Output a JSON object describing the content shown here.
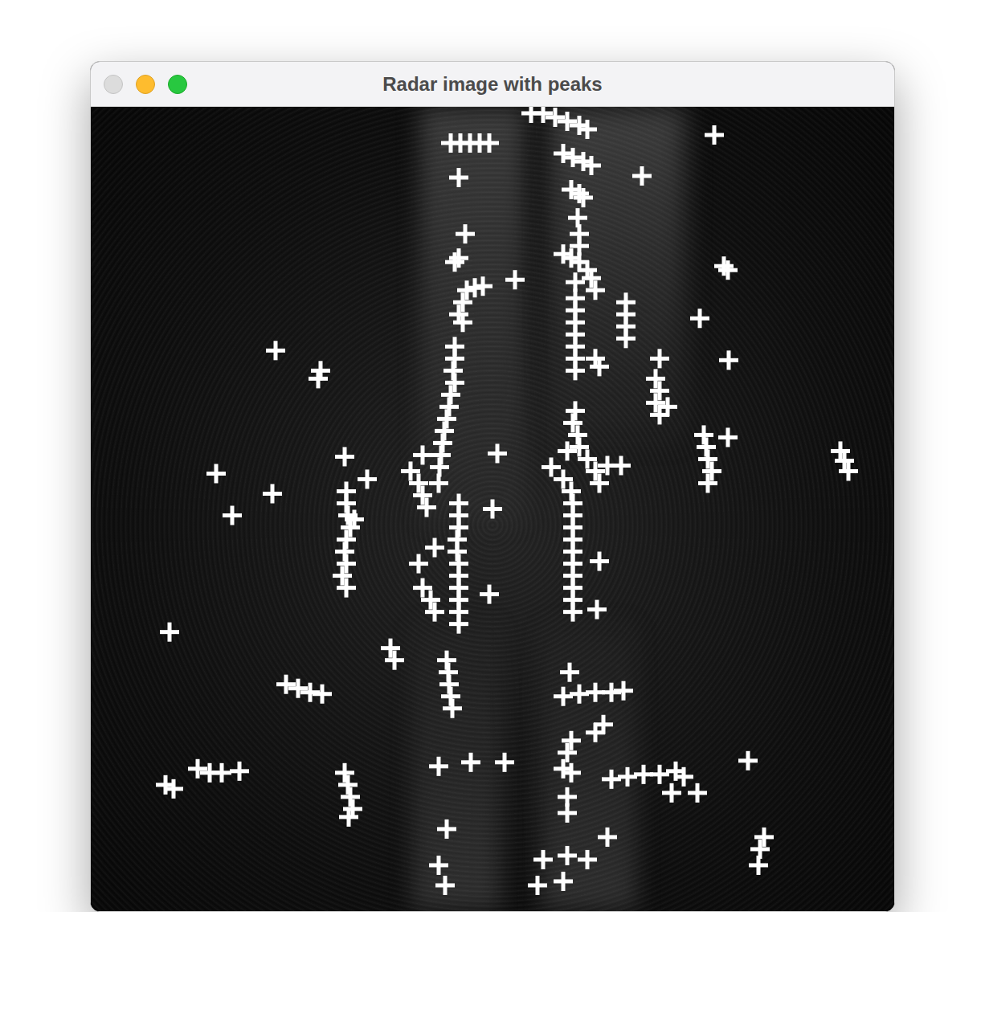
{
  "window": {
    "title": "Radar image with peaks",
    "controls": [
      {
        "name": "close",
        "disabled": true
      },
      {
        "name": "minimize",
        "disabled": false
      },
      {
        "name": "zoom",
        "disabled": false
      }
    ]
  },
  "radar_image": {
    "peaks": {
      "points": [
        [
          548,
          8
        ],
        [
          563,
          8
        ],
        [
          578,
          13
        ],
        [
          593,
          18
        ],
        [
          608,
          23
        ],
        [
          618,
          28
        ],
        [
          776,
          35
        ],
        [
          448,
          45
        ],
        [
          460,
          45
        ],
        [
          472,
          45
        ],
        [
          484,
          45
        ],
        [
          496,
          45
        ],
        [
          588,
          58
        ],
        [
          600,
          63
        ],
        [
          613,
          68
        ],
        [
          623,
          73
        ],
        [
          458,
          88
        ],
        [
          686,
          86
        ],
        [
          598,
          103
        ],
        [
          608,
          108
        ],
        [
          613,
          113
        ],
        [
          606,
          138
        ],
        [
          608,
          158
        ],
        [
          608,
          173
        ],
        [
          466,
          158
        ],
        [
          458,
          188
        ],
        [
          453,
          193
        ],
        [
          588,
          183
        ],
        [
          598,
          188
        ],
        [
          608,
          193
        ],
        [
          618,
          203
        ],
        [
          623,
          213
        ],
        [
          628,
          228
        ],
        [
          528,
          215
        ],
        [
          468,
          228
        ],
        [
          478,
          225
        ],
        [
          488,
          223
        ],
        [
          463,
          243
        ],
        [
          458,
          258
        ],
        [
          463,
          268
        ],
        [
          788,
          198
        ],
        [
          793,
          203
        ],
        [
          603,
          218
        ],
        [
          603,
          238
        ],
        [
          603,
          253
        ],
        [
          603,
          268
        ],
        [
          603,
          283
        ],
        [
          603,
          298
        ],
        [
          603,
          313
        ],
        [
          603,
          328
        ],
        [
          666,
          243
        ],
        [
          666,
          258
        ],
        [
          666,
          273
        ],
        [
          666,
          288
        ],
        [
          758,
          263
        ],
        [
          453,
          298
        ],
        [
          453,
          313
        ],
        [
          451,
          328
        ],
        [
          453,
          343
        ],
        [
          448,
          358
        ],
        [
          446,
          373
        ],
        [
          443,
          388
        ],
        [
          440,
          403
        ],
        [
          438,
          418
        ],
        [
          436,
          433
        ],
        [
          434,
          448
        ],
        [
          433,
          468
        ],
        [
          628,
          313
        ],
        [
          633,
          323
        ],
        [
          708,
          313
        ],
        [
          703,
          338
        ],
        [
          708,
          353
        ],
        [
          703,
          368
        ],
        [
          708,
          383
        ],
        [
          718,
          373
        ],
        [
          794,
          315
        ],
        [
          230,
          303
        ],
        [
          286,
          328
        ],
        [
          283,
          338
        ],
        [
          603,
          378
        ],
        [
          600,
          393
        ],
        [
          606,
          408
        ],
        [
          593,
          428
        ],
        [
          608,
          423
        ],
        [
          618,
          438
        ],
        [
          628,
          453
        ],
        [
          643,
          446
        ],
        [
          660,
          446
        ],
        [
          633,
          468
        ],
        [
          763,
          408
        ],
        [
          766,
          423
        ],
        [
          768,
          438
        ],
        [
          773,
          453
        ],
        [
          768,
          468
        ],
        [
          793,
          411
        ],
        [
          933,
          428
        ],
        [
          938,
          440
        ],
        [
          943,
          453
        ],
        [
          316,
          435
        ],
        [
          344,
          463
        ],
        [
          413,
          433
        ],
        [
          398,
          453
        ],
        [
          408,
          468
        ],
        [
          413,
          483
        ],
        [
          418,
          498
        ],
        [
          506,
          431
        ],
        [
          156,
          456
        ],
        [
          226,
          481
        ],
        [
          176,
          508
        ],
        [
          318,
          478
        ],
        [
          318,
          493
        ],
        [
          320,
          508
        ],
        [
          323,
          523
        ],
        [
          318,
          538
        ],
        [
          316,
          553
        ],
        [
          318,
          568
        ],
        [
          313,
          583
        ],
        [
          318,
          598
        ],
        [
          328,
          513
        ],
        [
          573,
          448
        ],
        [
          588,
          463
        ],
        [
          598,
          478
        ],
        [
          600,
          493
        ],
        [
          600,
          508
        ],
        [
          600,
          523
        ],
        [
          600,
          538
        ],
        [
          600,
          553
        ],
        [
          600,
          568
        ],
        [
          600,
          583
        ],
        [
          600,
          598
        ],
        [
          600,
          613
        ],
        [
          600,
          628
        ],
        [
          500,
          500
        ],
        [
          458,
          493
        ],
        [
          458,
          508
        ],
        [
          458,
          523
        ],
        [
          456,
          538
        ],
        [
          456,
          553
        ],
        [
          458,
          568
        ],
        [
          458,
          583
        ],
        [
          458,
          598
        ],
        [
          458,
          613
        ],
        [
          458,
          628
        ],
        [
          458,
          643
        ],
        [
          428,
          548
        ],
        [
          408,
          568
        ],
        [
          633,
          565
        ],
        [
          413,
          598
        ],
        [
          423,
          613
        ],
        [
          428,
          628
        ],
        [
          496,
          606
        ],
        [
          630,
          625
        ],
        [
          98,
          653
        ],
        [
          373,
          673
        ],
        [
          378,
          688
        ],
        [
          443,
          688
        ],
        [
          445,
          703
        ],
        [
          446,
          718
        ],
        [
          448,
          733
        ],
        [
          450,
          748
        ],
        [
          596,
          703
        ],
        [
          243,
          718
        ],
        [
          258,
          723
        ],
        [
          273,
          728
        ],
        [
          288,
          730
        ],
        [
          588,
          733
        ],
        [
          608,
          730
        ],
        [
          628,
          728
        ],
        [
          648,
          728
        ],
        [
          663,
          726
        ],
        [
          638,
          768
        ],
        [
          628,
          778
        ],
        [
          598,
          788
        ],
        [
          593,
          803
        ],
        [
          433,
          820
        ],
        [
          473,
          815
        ],
        [
          515,
          815
        ],
        [
          588,
          823
        ],
        [
          598,
          828
        ],
        [
          818,
          813
        ],
        [
          133,
          823
        ],
        [
          148,
          828
        ],
        [
          163,
          828
        ],
        [
          185,
          826
        ],
        [
          93,
          843
        ],
        [
          103,
          848
        ],
        [
          316,
          828
        ],
        [
          320,
          843
        ],
        [
          323,
          858
        ],
        [
          326,
          873
        ],
        [
          321,
          883
        ],
        [
          648,
          836
        ],
        [
          668,
          833
        ],
        [
          688,
          830
        ],
        [
          708,
          830
        ],
        [
          728,
          826
        ],
        [
          738,
          833
        ],
        [
          723,
          853
        ],
        [
          755,
          853
        ],
        [
          593,
          858
        ],
        [
          593,
          878
        ],
        [
          443,
          898
        ],
        [
          643,
          908
        ],
        [
          838,
          908
        ],
        [
          833,
          923
        ],
        [
          831,
          943
        ],
        [
          563,
          936
        ],
        [
          593,
          931
        ],
        [
          618,
          936
        ],
        [
          556,
          968
        ],
        [
          588,
          963
        ],
        [
          433,
          943
        ],
        [
          441,
          968
        ]
      ]
    }
  }
}
